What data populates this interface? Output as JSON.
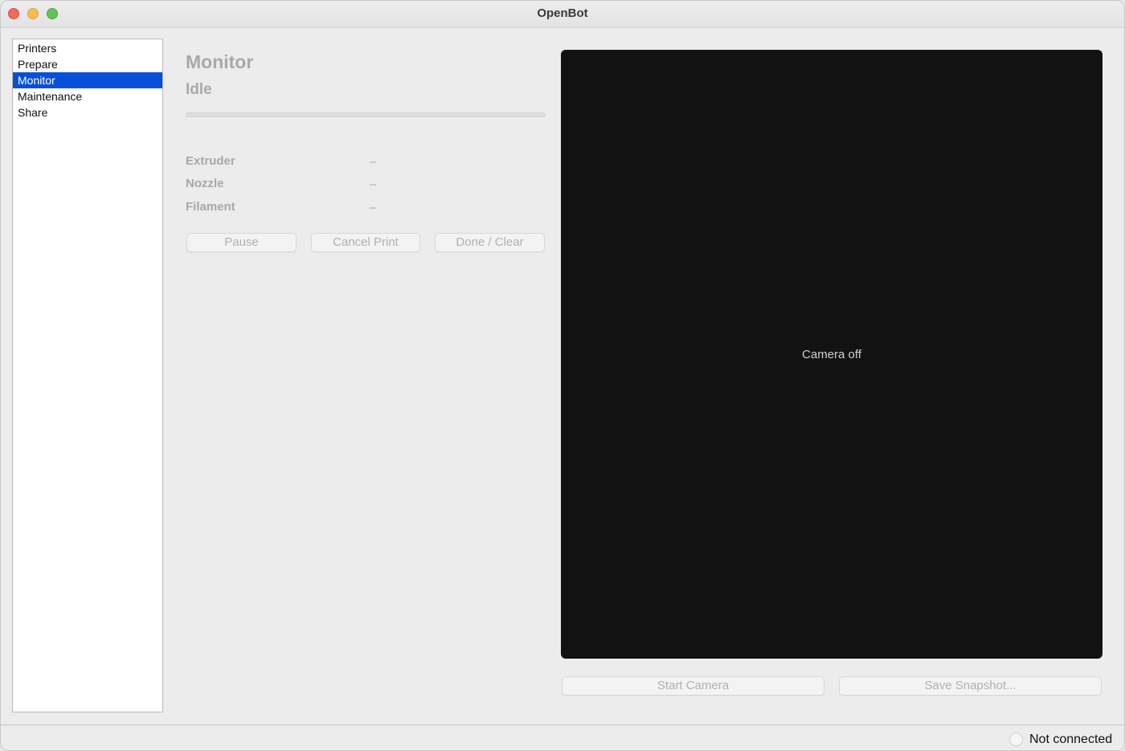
{
  "window": {
    "title": "OpenBot"
  },
  "sidebar": {
    "items": [
      {
        "label": "Printers",
        "selected": false
      },
      {
        "label": "Prepare",
        "selected": false
      },
      {
        "label": "Monitor",
        "selected": true
      },
      {
        "label": "Maintenance",
        "selected": false
      },
      {
        "label": "Share",
        "selected": false
      }
    ]
  },
  "monitor": {
    "title": "Monitor",
    "status": "Idle",
    "progress_fraction": 0,
    "rows": [
      {
        "label": "Extruder",
        "value": "–"
      },
      {
        "label": "Nozzle",
        "value": "–"
      },
      {
        "label": "Filament",
        "value": "–"
      }
    ],
    "buttons": {
      "pause": "Pause",
      "cancel": "Cancel Print",
      "done": "Done / Clear"
    }
  },
  "camera": {
    "placeholder": "Camera off",
    "start_label": "Start Camera",
    "snapshot_label": "Save Snapshot..."
  },
  "statusbar": {
    "connection": "Not connected"
  },
  "colors": {
    "selection": "#0a4fd8",
    "camera_bg": "#121212",
    "disabled_text": "#a8a8a8"
  }
}
